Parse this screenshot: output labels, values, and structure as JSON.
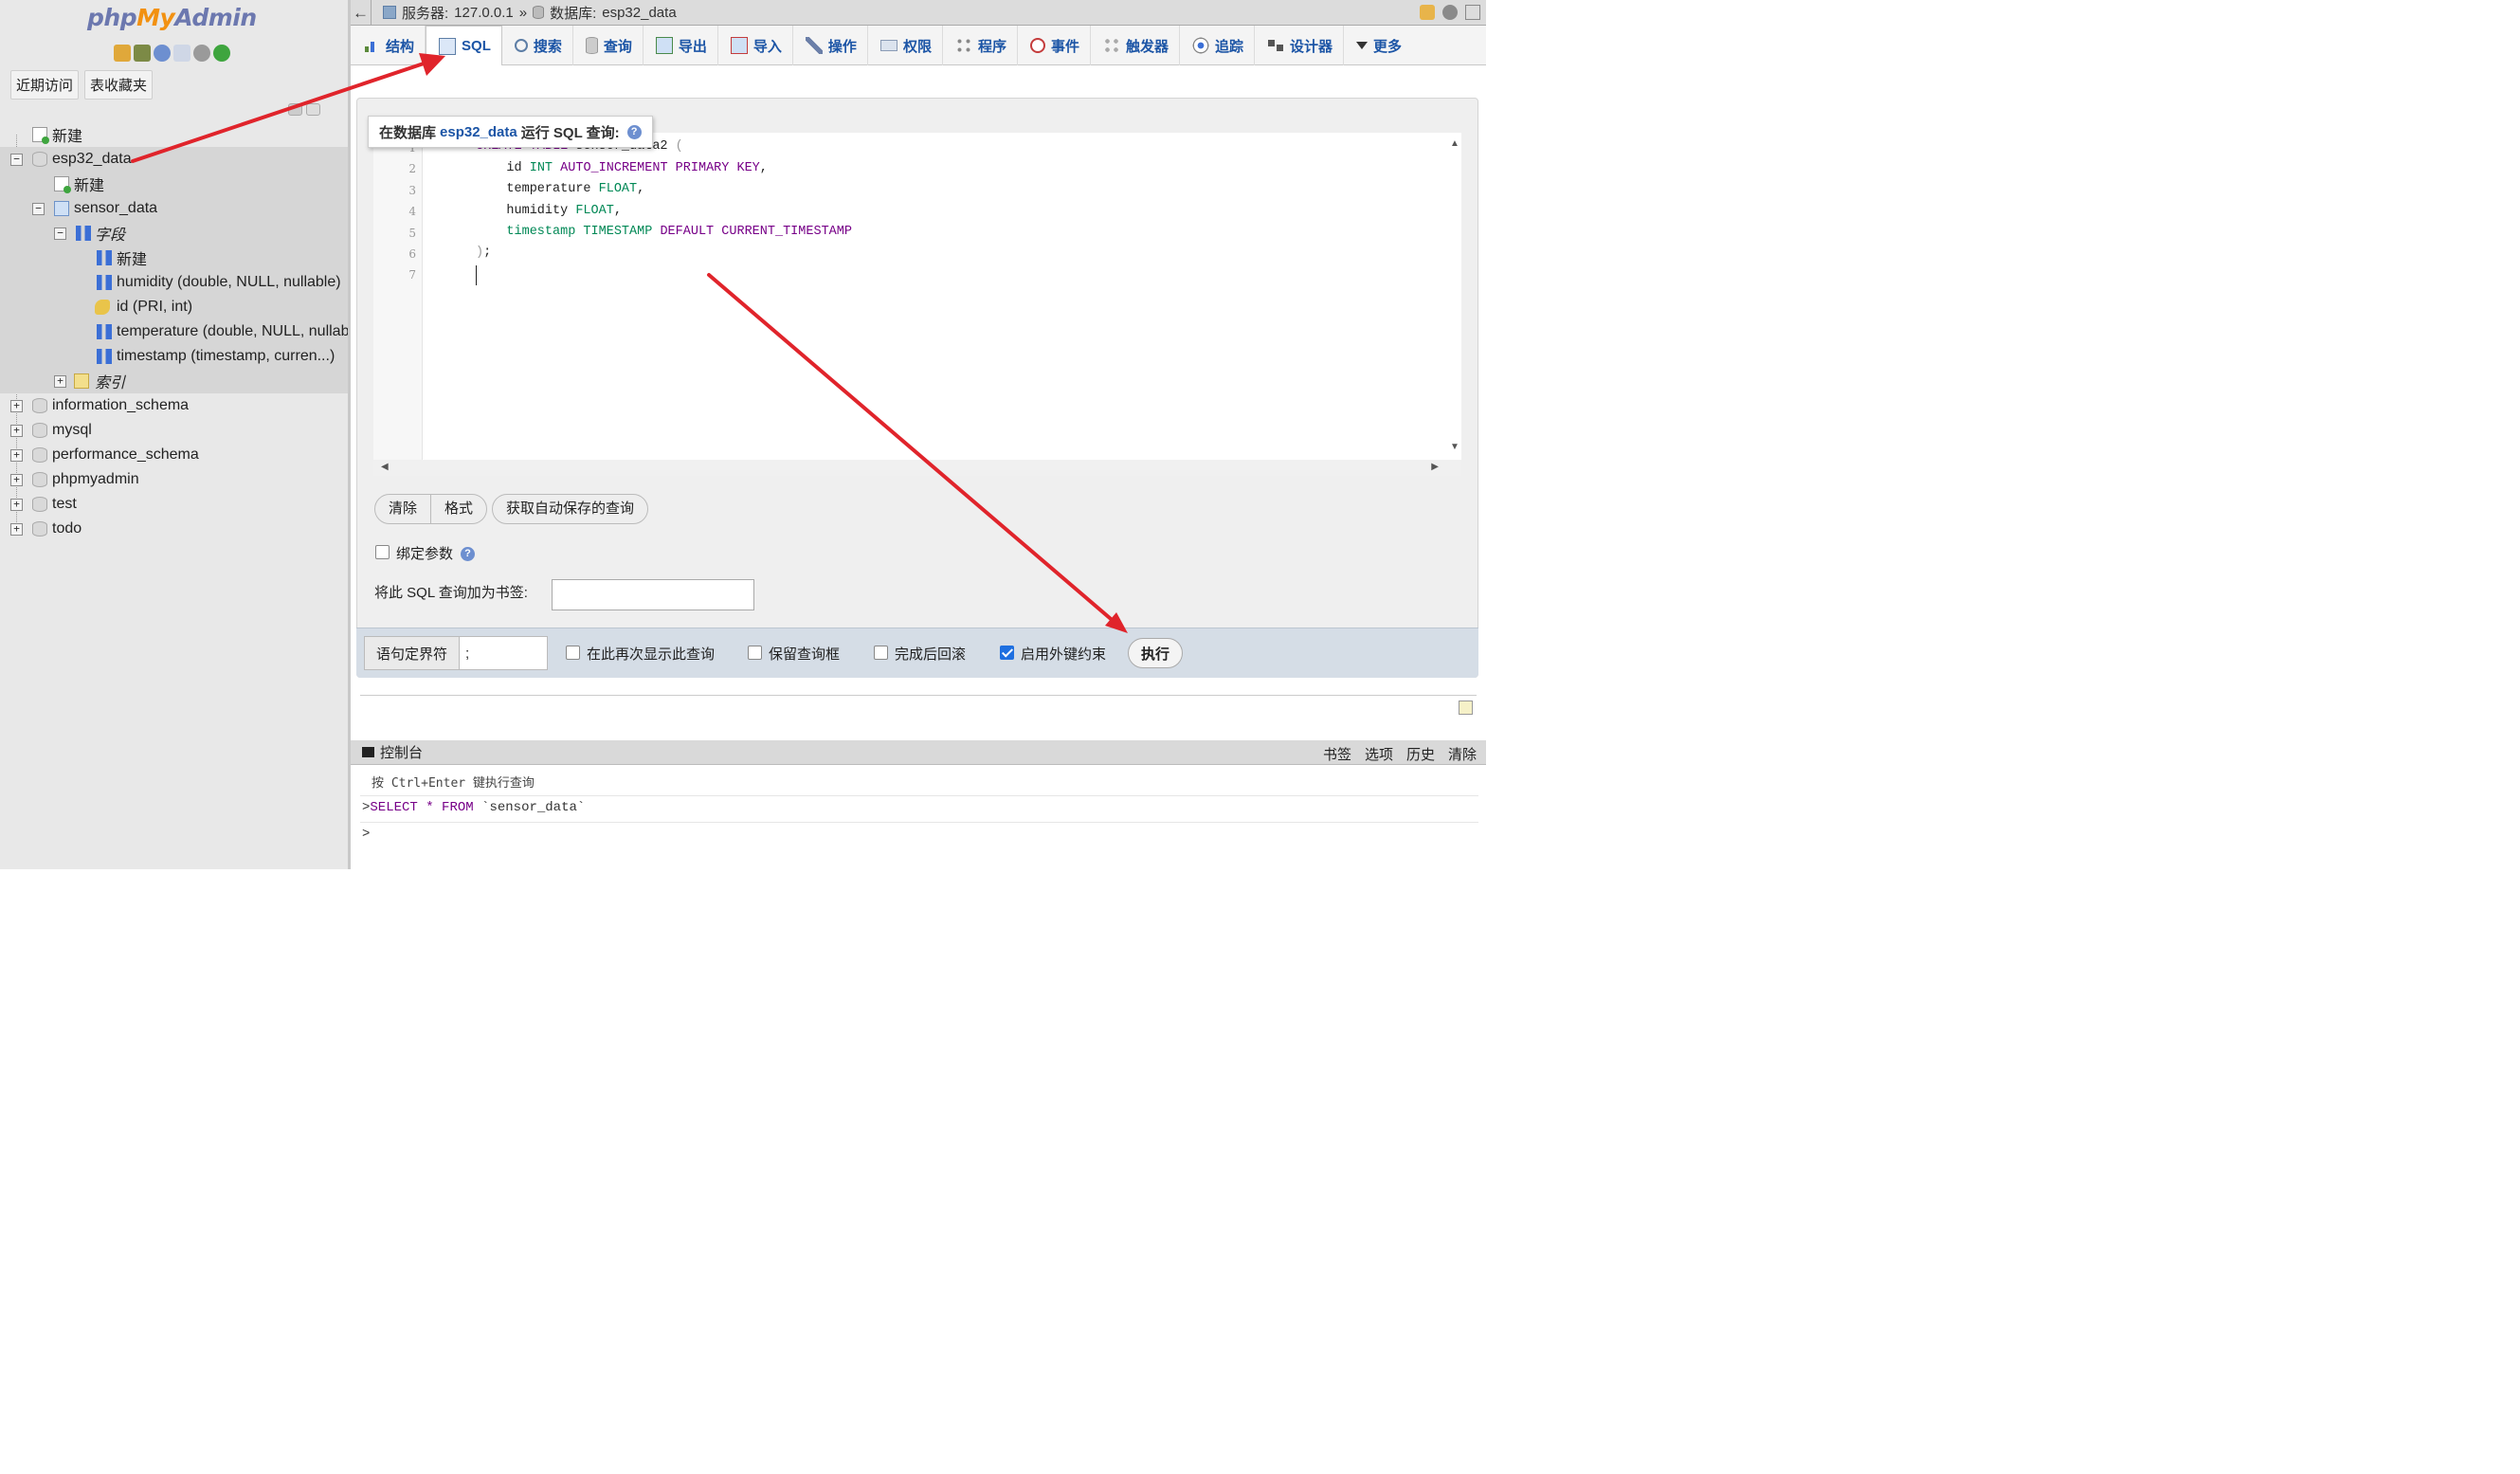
{
  "nav": {
    "logo": {
      "php": "php",
      "my": "My",
      "admin": "Admin"
    },
    "tabs": [
      "近期访问",
      "表收藏夹"
    ],
    "tree": {
      "new_root": "新建",
      "db_active": "esp32_data",
      "db_new": "新建",
      "table": "sensor_data",
      "fields_group": "字段",
      "field_new": "新建",
      "fields": [
        "humidity (double, NULL, nullable)",
        "id (PRI, int)",
        "temperature (double, NULL, nullable)",
        "timestamp (timestamp, curren...)"
      ],
      "index_group": "索引",
      "other_dbs": [
        "information_schema",
        "mysql",
        "performance_schema",
        "phpmyadmin",
        "test",
        "todo"
      ]
    }
  },
  "topbar": {
    "server_label": "服务器:",
    "server_value": "127.0.0.1",
    "sep": "»",
    "db_label": "数据库:",
    "db_value": "esp32_data"
  },
  "menu": [
    {
      "key": "structure",
      "label": "结构",
      "icon": "structure-icon"
    },
    {
      "key": "sql",
      "label": "SQL",
      "icon": "sql-icon",
      "active": true
    },
    {
      "key": "search",
      "label": "搜索",
      "icon": "search-icon"
    },
    {
      "key": "query",
      "label": "查询",
      "icon": "query-icon"
    },
    {
      "key": "export",
      "label": "导出",
      "icon": "export-icon"
    },
    {
      "key": "import",
      "label": "导入",
      "icon": "import-icon"
    },
    {
      "key": "operations",
      "label": "操作",
      "icon": "wrench-icon"
    },
    {
      "key": "privileges",
      "label": "权限",
      "icon": "privileges-icon"
    },
    {
      "key": "routines",
      "label": "程序",
      "icon": "routines-icon"
    },
    {
      "key": "events",
      "label": "事件",
      "icon": "clock-icon"
    },
    {
      "key": "triggers",
      "label": "触发器",
      "icon": "trigger-icon"
    },
    {
      "key": "tracking",
      "label": "追踪",
      "icon": "eye-icon"
    },
    {
      "key": "designer",
      "label": "设计器",
      "icon": "designer-icon"
    },
    {
      "key": "more",
      "label": "更多",
      "icon": "chevron-down-icon"
    }
  ],
  "sql_panel": {
    "legend_prefix": "在数据库",
    "legend_db": "esp32_data",
    "legend_suffix": "运行 SQL 查询:",
    "line_numbers": [
      "1",
      "2",
      "3",
      "4",
      "5",
      "6",
      "7"
    ],
    "code": {
      "l1_kw1": "CREATE TABLE",
      "l1_name": " sensor_data2 ",
      "l1_paren": "(",
      "l2_indent": "    id ",
      "l2_ty": "INT",
      "l2_sp": " ",
      "l2_kw": "AUTO_INCREMENT PRIMARY KEY",
      "l2_end": ",",
      "l3_indent": "    temperature ",
      "l3_ty": "FLOAT",
      "l3_end": ",",
      "l4_indent": "    humidity ",
      "l4_ty": "FLOAT",
      "l4_end": ",",
      "l5_ty1": "    timestamp TIMESTAMP",
      "l5_sp": " ",
      "l5_kw": "DEFAULT CURRENT_TIMESTAMP",
      "l6_paren": ")",
      "l6_end": ";"
    },
    "buttons": {
      "clear": "清除",
      "format": "格式",
      "autosave": "获取自动保存的查询"
    },
    "bind_params": "绑定参数",
    "bookmark_label": "将此 SQL 查询加为书签:",
    "bookmark_value": ""
  },
  "footer": {
    "delimiter_label": "语句定界符",
    "delimiter_value": ";",
    "show_again": "在此再次显示此查询",
    "retain_box": "保留查询框",
    "rollback": "完成后回滚",
    "fk_checks": "启用外键约束",
    "fk_checks_checked": true,
    "go": "执行"
  },
  "console": {
    "title": "控制台",
    "links": [
      "书签",
      "选项",
      "历史",
      "清除"
    ],
    "hint_prefix": "按 ",
    "hint_key": "Ctrl+Enter",
    "hint_suffix": " 键执行查询",
    "history_prompt": ">",
    "history_kw1": "SELECT",
    "history_star": " * ",
    "history_kw2": "FROM",
    "history_rest": " `sensor_data`",
    "input_prompt": ">"
  },
  "colors": {
    "accent": "#1c55a6",
    "arrow": "#e0242b",
    "keyword": "#770088",
    "type": "#008855"
  }
}
